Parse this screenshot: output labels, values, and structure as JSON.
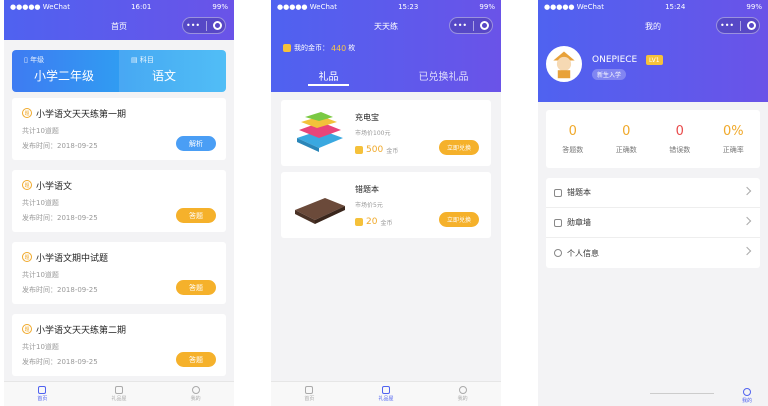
{
  "phone1": {
    "status": {
      "carrier": "●●●●● WeChat",
      "time": "16:01",
      "battery": "99%"
    },
    "title": "首页",
    "capsule": {
      "more": "•••"
    },
    "grade": {
      "grade_tag": "年级",
      "grade_value": "小学二年级",
      "subject_tag": "科目",
      "subject_value": "语文"
    },
    "quizzes": [
      {
        "title": "小学语文天天练第一期",
        "count": "共计10道题",
        "date": "发布时间：2018-09-25",
        "button": "解析"
      },
      {
        "title": "小学语文",
        "count": "共计10道题",
        "date": "发布时间：2018-09-25",
        "button": "答题"
      },
      {
        "title": "小学语文期中试题",
        "count": "共计10道题",
        "date": "发布时间：2018-09-25",
        "button": "答题"
      },
      {
        "title": "小学语文天天练第二期",
        "count": "共计10道题",
        "date": "发布时间：2018-09-25",
        "button": "答题"
      }
    ],
    "tabs": [
      "首页",
      "礼品屋",
      "我的"
    ]
  },
  "phone2": {
    "status": {
      "carrier": "●●●●● WeChat",
      "time": "15:23",
      "battery": "99%"
    },
    "title": "天天练",
    "coins": {
      "label": "我的金币：",
      "value": "440",
      "unit": "枚"
    },
    "tabs": [
      "礼品",
      "已兑换礼品"
    ],
    "gifts": [
      {
        "name": "充电宝",
        "price": "市场价100元",
        "coins": "500",
        "coin_unit": "金币",
        "button": "立即兑换"
      },
      {
        "name": "错题本",
        "price": "市场价5元",
        "coins": "20",
        "coin_unit": "金币",
        "button": "立即兑换"
      }
    ],
    "bottom_tabs": [
      "首页",
      "礼品屋",
      "我的"
    ]
  },
  "phone3": {
    "status": {
      "carrier": "●●●●● WeChat",
      "time": "15:24",
      "battery": "99%"
    },
    "title": "我的",
    "user": {
      "name": "ONEPIECE",
      "level": "LV1",
      "badge": "新生入学"
    },
    "stats": [
      {
        "value": "0",
        "label": "答题数",
        "color": "#f0a92b"
      },
      {
        "value": "0",
        "label": "正确数",
        "color": "#f0a92b"
      },
      {
        "value": "0",
        "label": "错误数",
        "color": "#e94b4b"
      },
      {
        "value": "0%",
        "label": "正确率",
        "color": "#f0a92b"
      }
    ],
    "menu": [
      "错题本",
      "勋章墙",
      "个人信息"
    ],
    "tab": "我的"
  },
  "colors": {
    "nav_gradient_start": "#4f62f0",
    "nav_gradient_end": "#6a53e8",
    "accent_orange": "#f5b12b",
    "accent_blue": "#4a9ef5"
  }
}
